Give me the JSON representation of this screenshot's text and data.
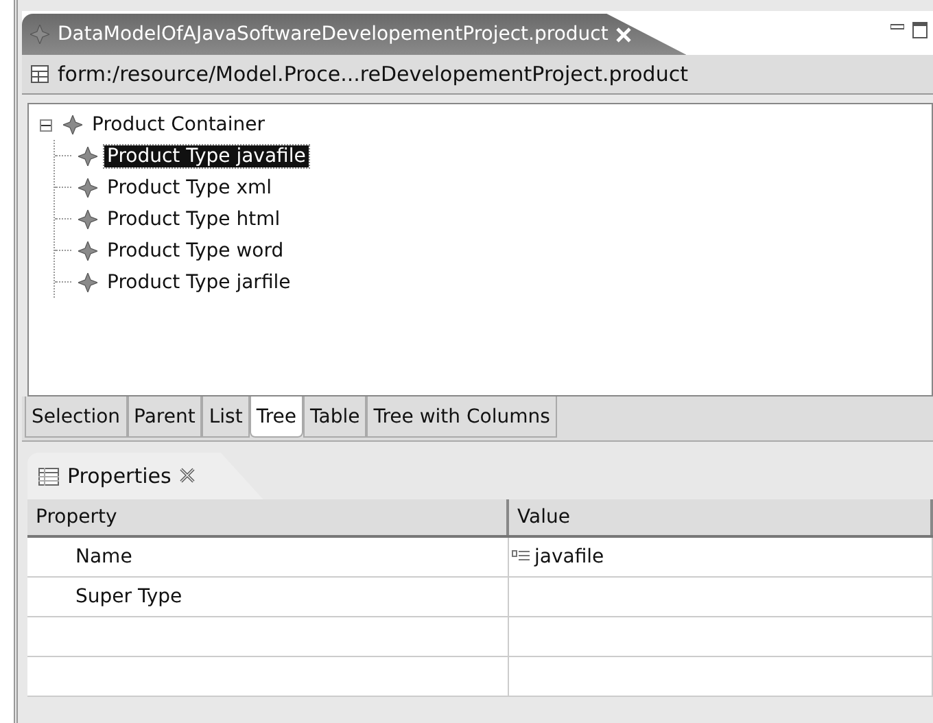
{
  "editor": {
    "tab_title": "DataModelOfAJavaSoftwareDevelopementProject.product",
    "path": "form:/resource/Model.Proce...reDevelopementProject.product",
    "tree": {
      "label": "Product Container",
      "expanded": true,
      "children": [
        {
          "label": "Product Type javafile",
          "selected": true
        },
        {
          "label": "Product Type xml",
          "selected": false
        },
        {
          "label": "Product Type html",
          "selected": false
        },
        {
          "label": "Product Type word",
          "selected": false
        },
        {
          "label": "Product Type jarfile",
          "selected": false
        }
      ]
    },
    "page_tabs": [
      {
        "label": "Selection",
        "selected": false
      },
      {
        "label": "Parent",
        "selected": false
      },
      {
        "label": "List",
        "selected": false
      },
      {
        "label": "Tree",
        "selected": true
      },
      {
        "label": "Table",
        "selected": false
      },
      {
        "label": "Tree with Columns",
        "selected": false
      }
    ]
  },
  "properties": {
    "tab_title": "Properties",
    "columns": [
      "Property",
      "Value"
    ],
    "rows": [
      {
        "property": "Name",
        "value": "javafile"
      },
      {
        "property": "Super Type",
        "value": null
      }
    ]
  }
}
